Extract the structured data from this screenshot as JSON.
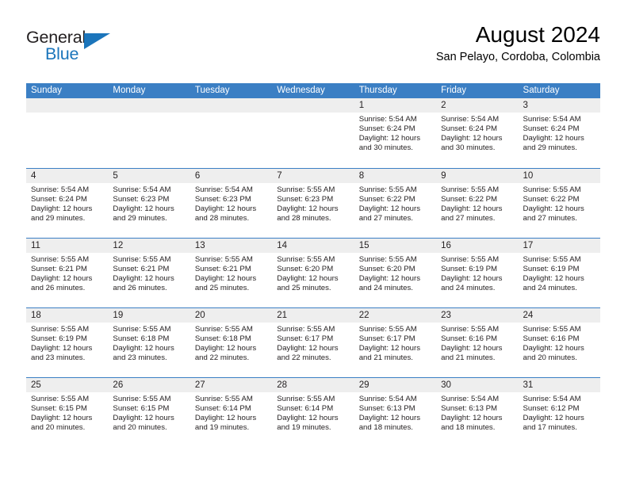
{
  "brand": {
    "name_top": "General",
    "name_bottom": "Blue",
    "triangle_icon": "triangle-icon",
    "color_dark": "#231f20",
    "color_blue": "#1b75bb"
  },
  "header": {
    "title": "August 2024",
    "subtitle": "San Pelayo, Cordoba, Colombia"
  },
  "theme": {
    "header_blue": "#3b7fc4",
    "day_band_gray": "#eeeeee",
    "text": "#231f20"
  },
  "weekdays": [
    "Sunday",
    "Monday",
    "Tuesday",
    "Wednesday",
    "Thursday",
    "Friday",
    "Saturday"
  ],
  "weeks": [
    [
      {
        "day": "",
        "lines": []
      },
      {
        "day": "",
        "lines": []
      },
      {
        "day": "",
        "lines": []
      },
      {
        "day": "",
        "lines": []
      },
      {
        "day": "1",
        "lines": [
          "Sunrise: 5:54 AM",
          "Sunset: 6:24 PM",
          "Daylight: 12 hours",
          "and 30 minutes."
        ]
      },
      {
        "day": "2",
        "lines": [
          "Sunrise: 5:54 AM",
          "Sunset: 6:24 PM",
          "Daylight: 12 hours",
          "and 30 minutes."
        ]
      },
      {
        "day": "3",
        "lines": [
          "Sunrise: 5:54 AM",
          "Sunset: 6:24 PM",
          "Daylight: 12 hours",
          "and 29 minutes."
        ]
      }
    ],
    [
      {
        "day": "4",
        "lines": [
          "Sunrise: 5:54 AM",
          "Sunset: 6:24 PM",
          "Daylight: 12 hours",
          "and 29 minutes."
        ]
      },
      {
        "day": "5",
        "lines": [
          "Sunrise: 5:54 AM",
          "Sunset: 6:23 PM",
          "Daylight: 12 hours",
          "and 29 minutes."
        ]
      },
      {
        "day": "6",
        "lines": [
          "Sunrise: 5:54 AM",
          "Sunset: 6:23 PM",
          "Daylight: 12 hours",
          "and 28 minutes."
        ]
      },
      {
        "day": "7",
        "lines": [
          "Sunrise: 5:55 AM",
          "Sunset: 6:23 PM",
          "Daylight: 12 hours",
          "and 28 minutes."
        ]
      },
      {
        "day": "8",
        "lines": [
          "Sunrise: 5:55 AM",
          "Sunset: 6:22 PM",
          "Daylight: 12 hours",
          "and 27 minutes."
        ]
      },
      {
        "day": "9",
        "lines": [
          "Sunrise: 5:55 AM",
          "Sunset: 6:22 PM",
          "Daylight: 12 hours",
          "and 27 minutes."
        ]
      },
      {
        "day": "10",
        "lines": [
          "Sunrise: 5:55 AM",
          "Sunset: 6:22 PM",
          "Daylight: 12 hours",
          "and 27 minutes."
        ]
      }
    ],
    [
      {
        "day": "11",
        "lines": [
          "Sunrise: 5:55 AM",
          "Sunset: 6:21 PM",
          "Daylight: 12 hours",
          "and 26 minutes."
        ]
      },
      {
        "day": "12",
        "lines": [
          "Sunrise: 5:55 AM",
          "Sunset: 6:21 PM",
          "Daylight: 12 hours",
          "and 26 minutes."
        ]
      },
      {
        "day": "13",
        "lines": [
          "Sunrise: 5:55 AM",
          "Sunset: 6:21 PM",
          "Daylight: 12 hours",
          "and 25 minutes."
        ]
      },
      {
        "day": "14",
        "lines": [
          "Sunrise: 5:55 AM",
          "Sunset: 6:20 PM",
          "Daylight: 12 hours",
          "and 25 minutes."
        ]
      },
      {
        "day": "15",
        "lines": [
          "Sunrise: 5:55 AM",
          "Sunset: 6:20 PM",
          "Daylight: 12 hours",
          "and 24 minutes."
        ]
      },
      {
        "day": "16",
        "lines": [
          "Sunrise: 5:55 AM",
          "Sunset: 6:19 PM",
          "Daylight: 12 hours",
          "and 24 minutes."
        ]
      },
      {
        "day": "17",
        "lines": [
          "Sunrise: 5:55 AM",
          "Sunset: 6:19 PM",
          "Daylight: 12 hours",
          "and 24 minutes."
        ]
      }
    ],
    [
      {
        "day": "18",
        "lines": [
          "Sunrise: 5:55 AM",
          "Sunset: 6:19 PM",
          "Daylight: 12 hours",
          "and 23 minutes."
        ]
      },
      {
        "day": "19",
        "lines": [
          "Sunrise: 5:55 AM",
          "Sunset: 6:18 PM",
          "Daylight: 12 hours",
          "and 23 minutes."
        ]
      },
      {
        "day": "20",
        "lines": [
          "Sunrise: 5:55 AM",
          "Sunset: 6:18 PM",
          "Daylight: 12 hours",
          "and 22 minutes."
        ]
      },
      {
        "day": "21",
        "lines": [
          "Sunrise: 5:55 AM",
          "Sunset: 6:17 PM",
          "Daylight: 12 hours",
          "and 22 minutes."
        ]
      },
      {
        "day": "22",
        "lines": [
          "Sunrise: 5:55 AM",
          "Sunset: 6:17 PM",
          "Daylight: 12 hours",
          "and 21 minutes."
        ]
      },
      {
        "day": "23",
        "lines": [
          "Sunrise: 5:55 AM",
          "Sunset: 6:16 PM",
          "Daylight: 12 hours",
          "and 21 minutes."
        ]
      },
      {
        "day": "24",
        "lines": [
          "Sunrise: 5:55 AM",
          "Sunset: 6:16 PM",
          "Daylight: 12 hours",
          "and 20 minutes."
        ]
      }
    ],
    [
      {
        "day": "25",
        "lines": [
          "Sunrise: 5:55 AM",
          "Sunset: 6:15 PM",
          "Daylight: 12 hours",
          "and 20 minutes."
        ]
      },
      {
        "day": "26",
        "lines": [
          "Sunrise: 5:55 AM",
          "Sunset: 6:15 PM",
          "Daylight: 12 hours",
          "and 20 minutes."
        ]
      },
      {
        "day": "27",
        "lines": [
          "Sunrise: 5:55 AM",
          "Sunset: 6:14 PM",
          "Daylight: 12 hours",
          "and 19 minutes."
        ]
      },
      {
        "day": "28",
        "lines": [
          "Sunrise: 5:55 AM",
          "Sunset: 6:14 PM",
          "Daylight: 12 hours",
          "and 19 minutes."
        ]
      },
      {
        "day": "29",
        "lines": [
          "Sunrise: 5:54 AM",
          "Sunset: 6:13 PM",
          "Daylight: 12 hours",
          "and 18 minutes."
        ]
      },
      {
        "day": "30",
        "lines": [
          "Sunrise: 5:54 AM",
          "Sunset: 6:13 PM",
          "Daylight: 12 hours",
          "and 18 minutes."
        ]
      },
      {
        "day": "31",
        "lines": [
          "Sunrise: 5:54 AM",
          "Sunset: 6:12 PM",
          "Daylight: 12 hours",
          "and 17 minutes."
        ]
      }
    ]
  ]
}
